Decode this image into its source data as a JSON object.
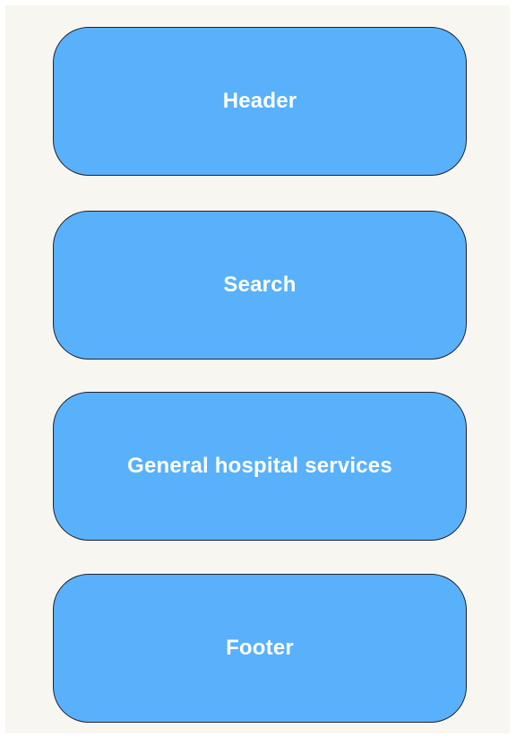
{
  "colors": {
    "background": "#f8f6f1",
    "block_fill": "#59b1fb",
    "block_border": "#1d2230",
    "label_text": "#ffffff"
  },
  "blocks": [
    {
      "label": "Header"
    },
    {
      "label": "Search"
    },
    {
      "label": "General hospital services"
    },
    {
      "label": "Footer"
    }
  ]
}
